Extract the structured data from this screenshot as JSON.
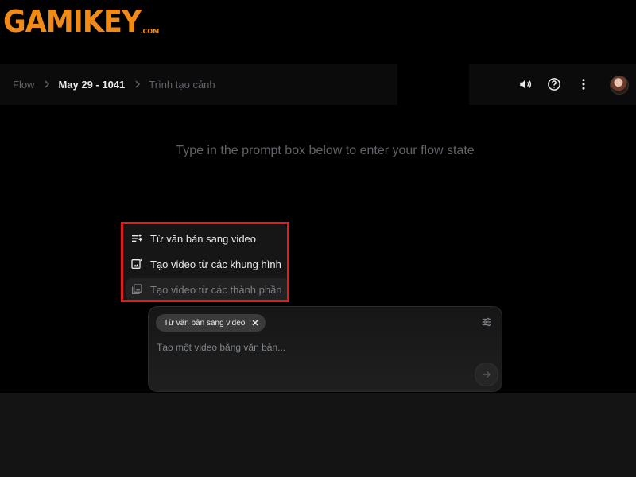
{
  "brand": {
    "logo_text": "GAMIKEY",
    "logo_suffix": ".COM",
    "color": "#f28a16"
  },
  "breadcrumb": {
    "items": [
      {
        "label": "Flow"
      },
      {
        "label": "May 29 - 1041"
      },
      {
        "label": "Trình tạo cảnh"
      }
    ]
  },
  "header_icons": [
    "volume-icon",
    "help-icon",
    "more-vert-icon",
    "avatar"
  ],
  "main": {
    "hint": "Type in the prompt box below to enter your flow state"
  },
  "mode_menu": {
    "highlight_color": "#e01e1e",
    "items": [
      {
        "label": "Từ văn bản sang video",
        "icon": "text-to-video-icon",
        "enabled": true
      },
      {
        "label": "Tạo video từ các khung hình",
        "icon": "frames-to-video-icon",
        "enabled": true
      },
      {
        "label": "Tạo video từ các thành phần",
        "icon": "ingredients-to-video-icon",
        "enabled": false
      }
    ]
  },
  "prompt": {
    "chip_label": "Từ văn bản sang video",
    "placeholder": "Tạo một video bằng văn bản...",
    "value": ""
  }
}
